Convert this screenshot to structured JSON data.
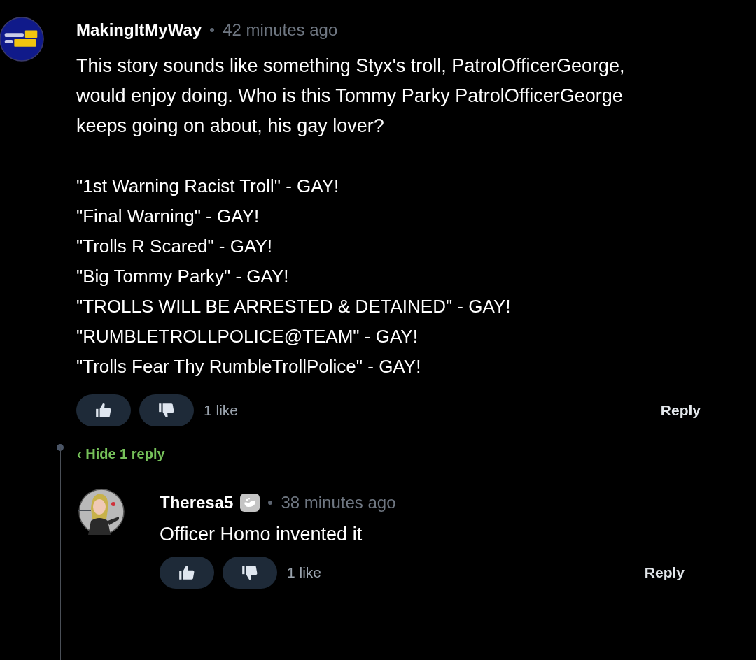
{
  "comment": {
    "author": "MakingItMyWay",
    "time": "42 minutes ago",
    "text": "This story sounds like something Styx's troll, PatrolOfficerGeorge, would enjoy doing. Who is this Tommy Parky PatrolOfficerGeorge keeps going on about, his gay lover?",
    "lines": [
      "\"1st Warning Racist Troll\" - GAY!",
      "\"Final Warning\" - GAY!",
      "\"Trolls R Scared\" - GAY!",
      "\"Big Tommy Parky\" - GAY!",
      "\"TROLLS WILL BE ARRESTED & DETAINED\" - GAY!",
      "\"RUMBLETROLLPOLICE@TEAM\" - GAY!",
      "\"Trolls Fear Thy RumbleTrollPolice\" - GAY!"
    ],
    "likes": "1 like",
    "reply": "Reply",
    "toggle": "‹ Hide 1 reply",
    "expanded": true,
    "avatar": {
      "kind": "logo"
    },
    "replies": [
      {
        "author": "Theresa5",
        "badge": true,
        "time": "38 minutes ago",
        "text": "Officer Homo invented it",
        "likes": "1 like",
        "reply": "Reply",
        "avatar": {
          "kind": "person"
        }
      }
    ]
  }
}
